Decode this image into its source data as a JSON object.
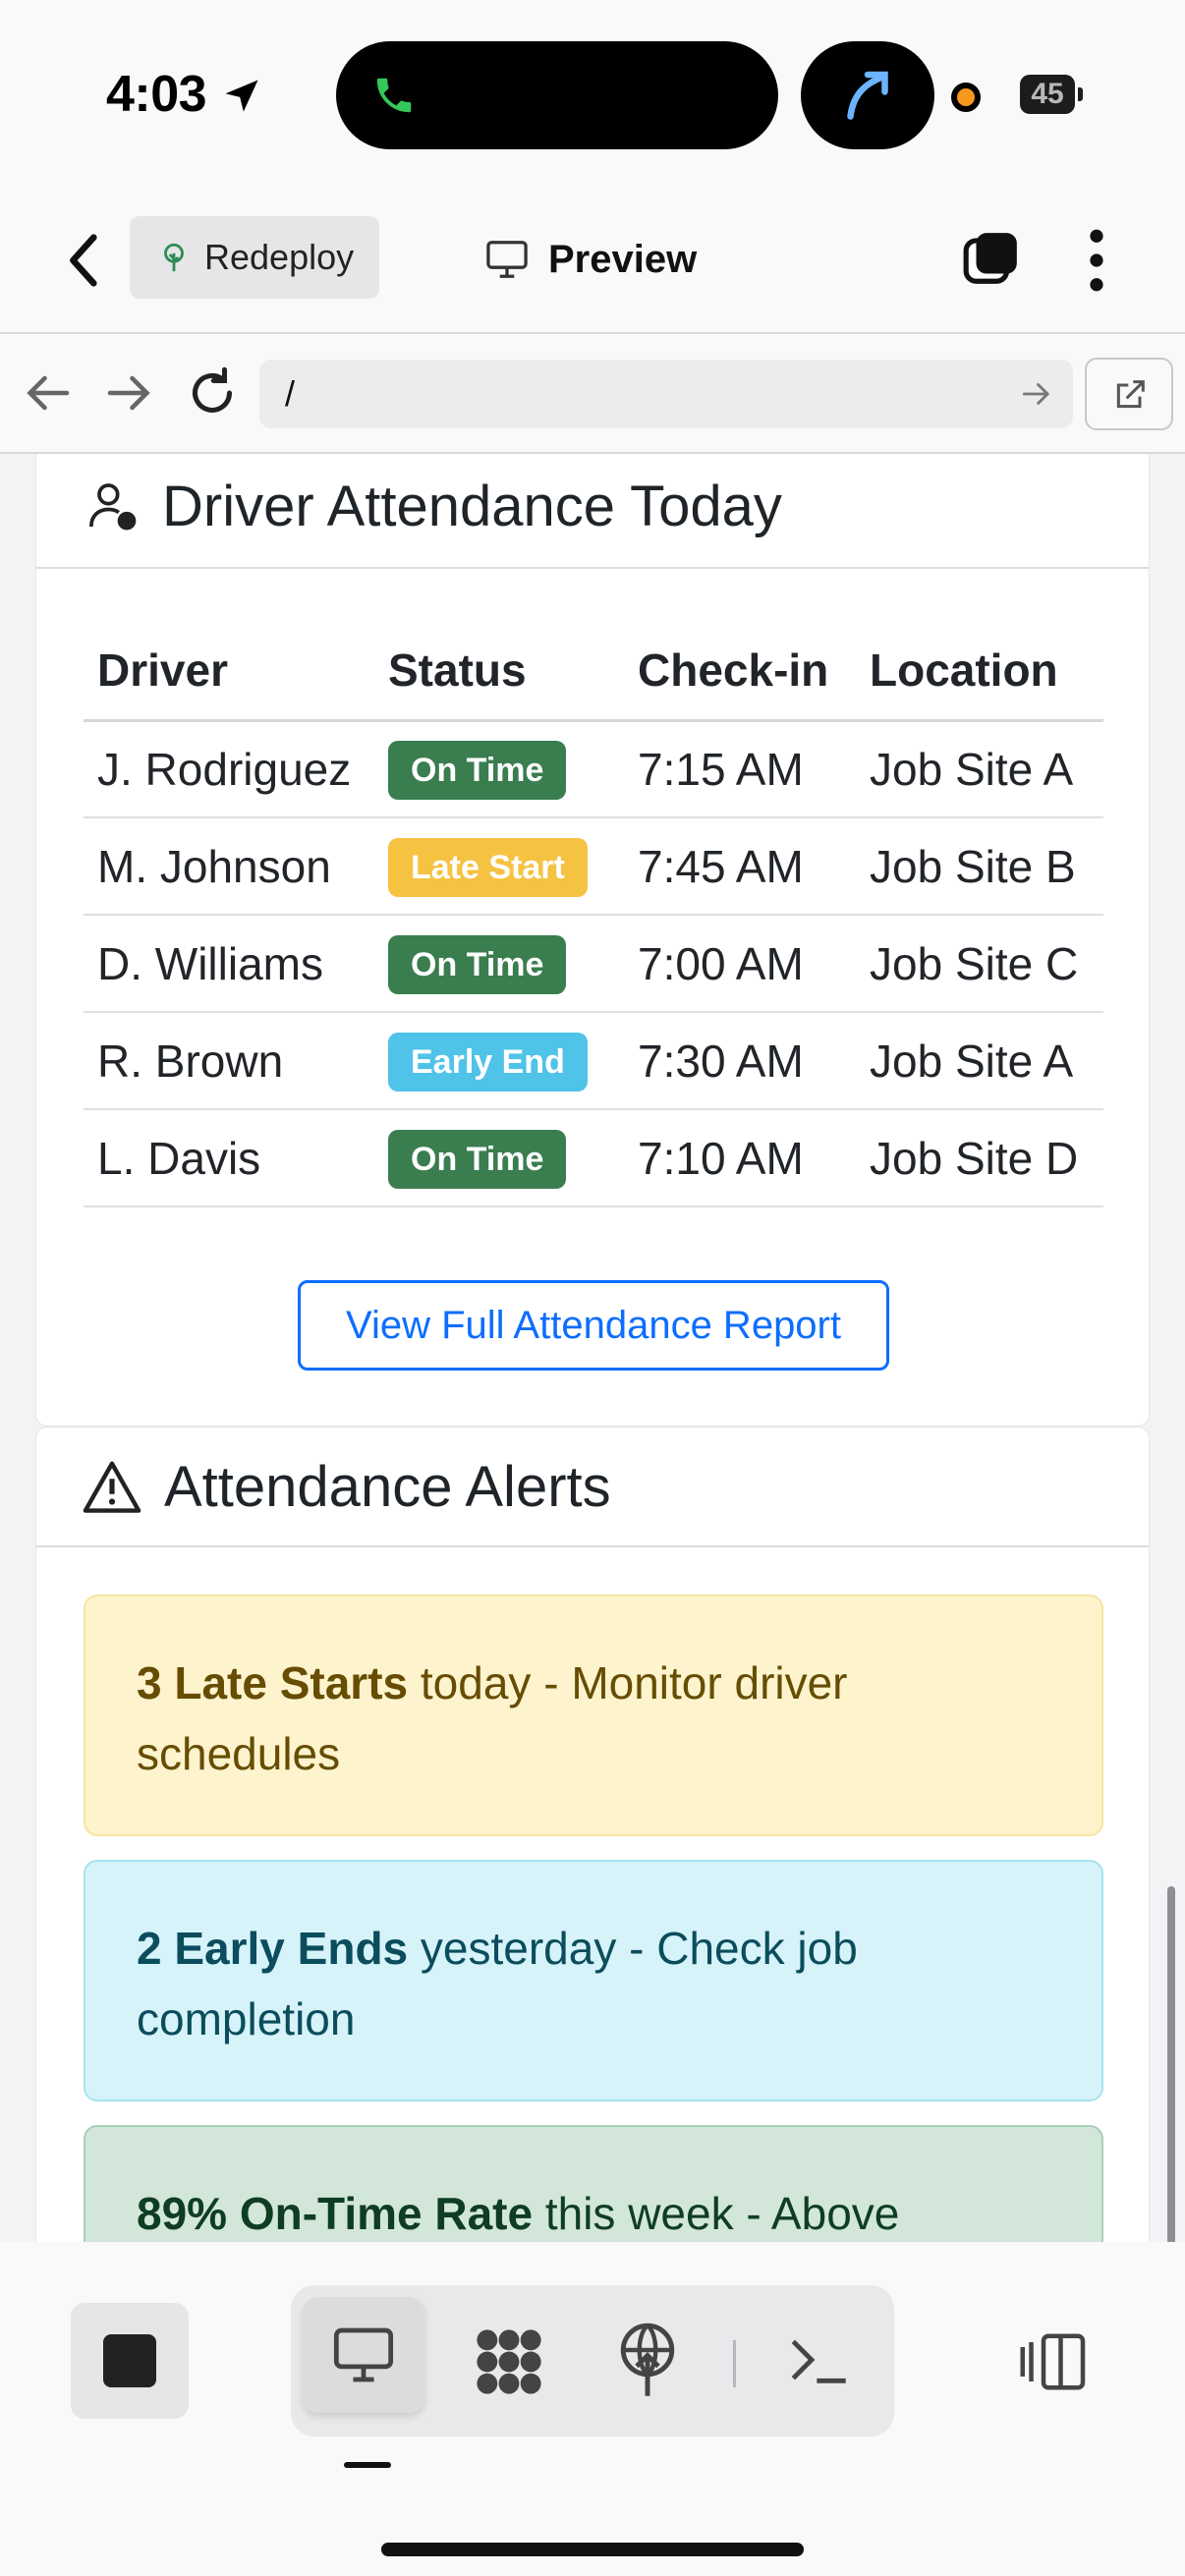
{
  "status_bar": {
    "time": "4:03",
    "battery": "45"
  },
  "app_header": {
    "redeploy_label": "Redeploy",
    "preview_label": "Preview"
  },
  "url_bar": {
    "url": "/"
  },
  "attendance_card": {
    "title": "Driver Attendance Today",
    "columns": [
      "Driver",
      "Status",
      "Check-in",
      "Location"
    ],
    "rows": [
      {
        "driver": "J. Rodriguez",
        "status": "On Time",
        "status_color": "#3a7d4f",
        "checkin": "7:15 AM",
        "location": "Job Site A"
      },
      {
        "driver": "M. Johnson",
        "status": "Late Start",
        "status_color": "#f5c242",
        "checkin": "7:45 AM",
        "location": "Job Site B"
      },
      {
        "driver": "D. Williams",
        "status": "On Time",
        "status_color": "#3a7d4f",
        "checkin": "7:00 AM",
        "location": "Job Site C"
      },
      {
        "driver": "R. Brown",
        "status": "Early End",
        "status_color": "#4fc3e8",
        "checkin": "7:30 AM",
        "location": "Job Site A"
      },
      {
        "driver": "L. Davis",
        "status": "On Time",
        "status_color": "#3a7d4f",
        "checkin": "7:10 AM",
        "location": "Job Site D"
      }
    ],
    "report_button": "View Full Attendance Report"
  },
  "alerts_card": {
    "title": "Attendance Alerts",
    "alerts": [
      {
        "bold": "3 Late Starts",
        "text": " today - Monitor driver schedules",
        "bg": "#fdf3cd",
        "border": "#f9e4a2",
        "color": "#664d03"
      },
      {
        "bold": "2 Early Ends",
        "text": " yesterday - Check job completion",
        "bg": "#d6f3fa",
        "border": "#a8e2ef",
        "color": "#0b4d5c"
      },
      {
        "bold": "89% On-Time Rate",
        "text": " this week - Above",
        "bg": "#d2e6da",
        "border": "#a9cfb6",
        "color": "#0f3d22"
      }
    ]
  },
  "colors": {
    "primary": "#0d6efd",
    "success": "#3a7d4f",
    "warning": "#f5c242",
    "info": "#4fc3e8"
  },
  "icons": [
    "location-arrow-icon",
    "phone-icon",
    "back-chevron-icon",
    "tree-icon",
    "monitor-icon",
    "tabs-icon",
    "more-vertical-icon",
    "arrow-left-icon",
    "arrow-right-icon",
    "reload-icon",
    "external-link-icon",
    "user-icon",
    "warning-triangle-icon",
    "stop-icon",
    "grid-icon",
    "deploy-icon",
    "terminal-icon",
    "side-panel-icon"
  ]
}
